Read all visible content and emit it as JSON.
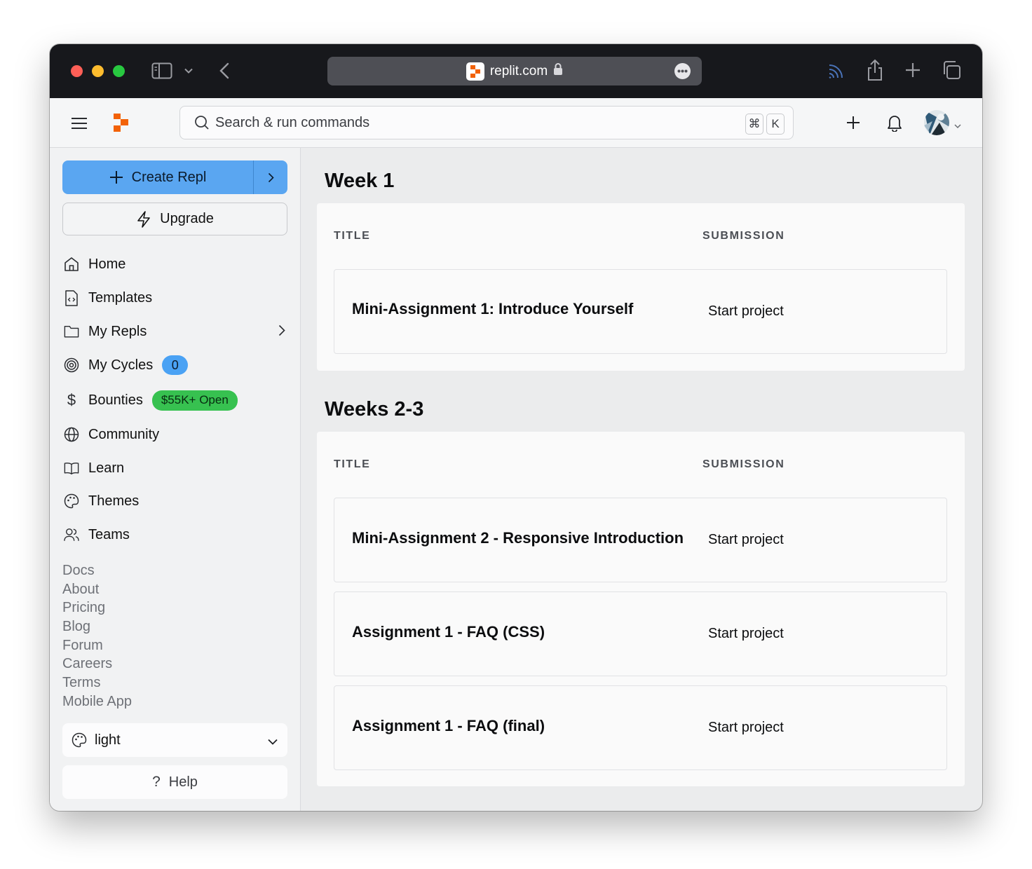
{
  "browser": {
    "url": "replit.com",
    "colors": {
      "close": "#fe5f57",
      "minimize": "#febc2e",
      "maximize": "#28c840"
    }
  },
  "topnav": {
    "search_placeholder": "Search & run commands",
    "shortcut_cmd": "⌘",
    "shortcut_key": "K"
  },
  "sidebar": {
    "create_label": "Create Repl",
    "upgrade_label": "Upgrade",
    "items": [
      {
        "label": "Home",
        "icon": "home-icon"
      },
      {
        "label": "Templates",
        "icon": "template-file-icon"
      },
      {
        "label": "My Repls",
        "icon": "folder-icon"
      },
      {
        "label": "My Cycles",
        "icon": "cycles-spiral-icon",
        "badge": "0"
      },
      {
        "label": "Bounties",
        "icon": "dollar-icon",
        "badge": "$55K+ Open"
      },
      {
        "label": "Community",
        "icon": "globe-icon"
      },
      {
        "label": "Learn",
        "icon": "book-icon"
      },
      {
        "label": "Themes",
        "icon": "palette-icon"
      },
      {
        "label": "Teams",
        "icon": "users-icon"
      }
    ],
    "footer_links": [
      "Docs",
      "About",
      "Pricing",
      "Blog",
      "Forum",
      "Careers",
      "Terms",
      "Mobile App"
    ],
    "theme_value": "light",
    "help_label": "Help"
  },
  "main": {
    "sections": [
      {
        "title": "Week 1",
        "col_title": "TITLE",
        "col_submission": "SUBMISSION",
        "rows": [
          {
            "title": "Mini-Assignment 1: Introduce Yourself",
            "action": "Start project"
          }
        ]
      },
      {
        "title": "Weeks 2-3",
        "col_title": "TITLE",
        "col_submission": "SUBMISSION",
        "rows": [
          {
            "title": "Mini-Assignment 2 - Responsive Introduction",
            "action": "Start project"
          },
          {
            "title": "Assignment 1 - FAQ (CSS)",
            "action": "Start project"
          },
          {
            "title": "Assignment 1 - FAQ (final)",
            "action": "Start project"
          }
        ]
      }
    ]
  },
  "colors": {
    "accent": "#5aa6f1",
    "bounty_green": "#37c150",
    "brand_orange": "#f26207"
  }
}
